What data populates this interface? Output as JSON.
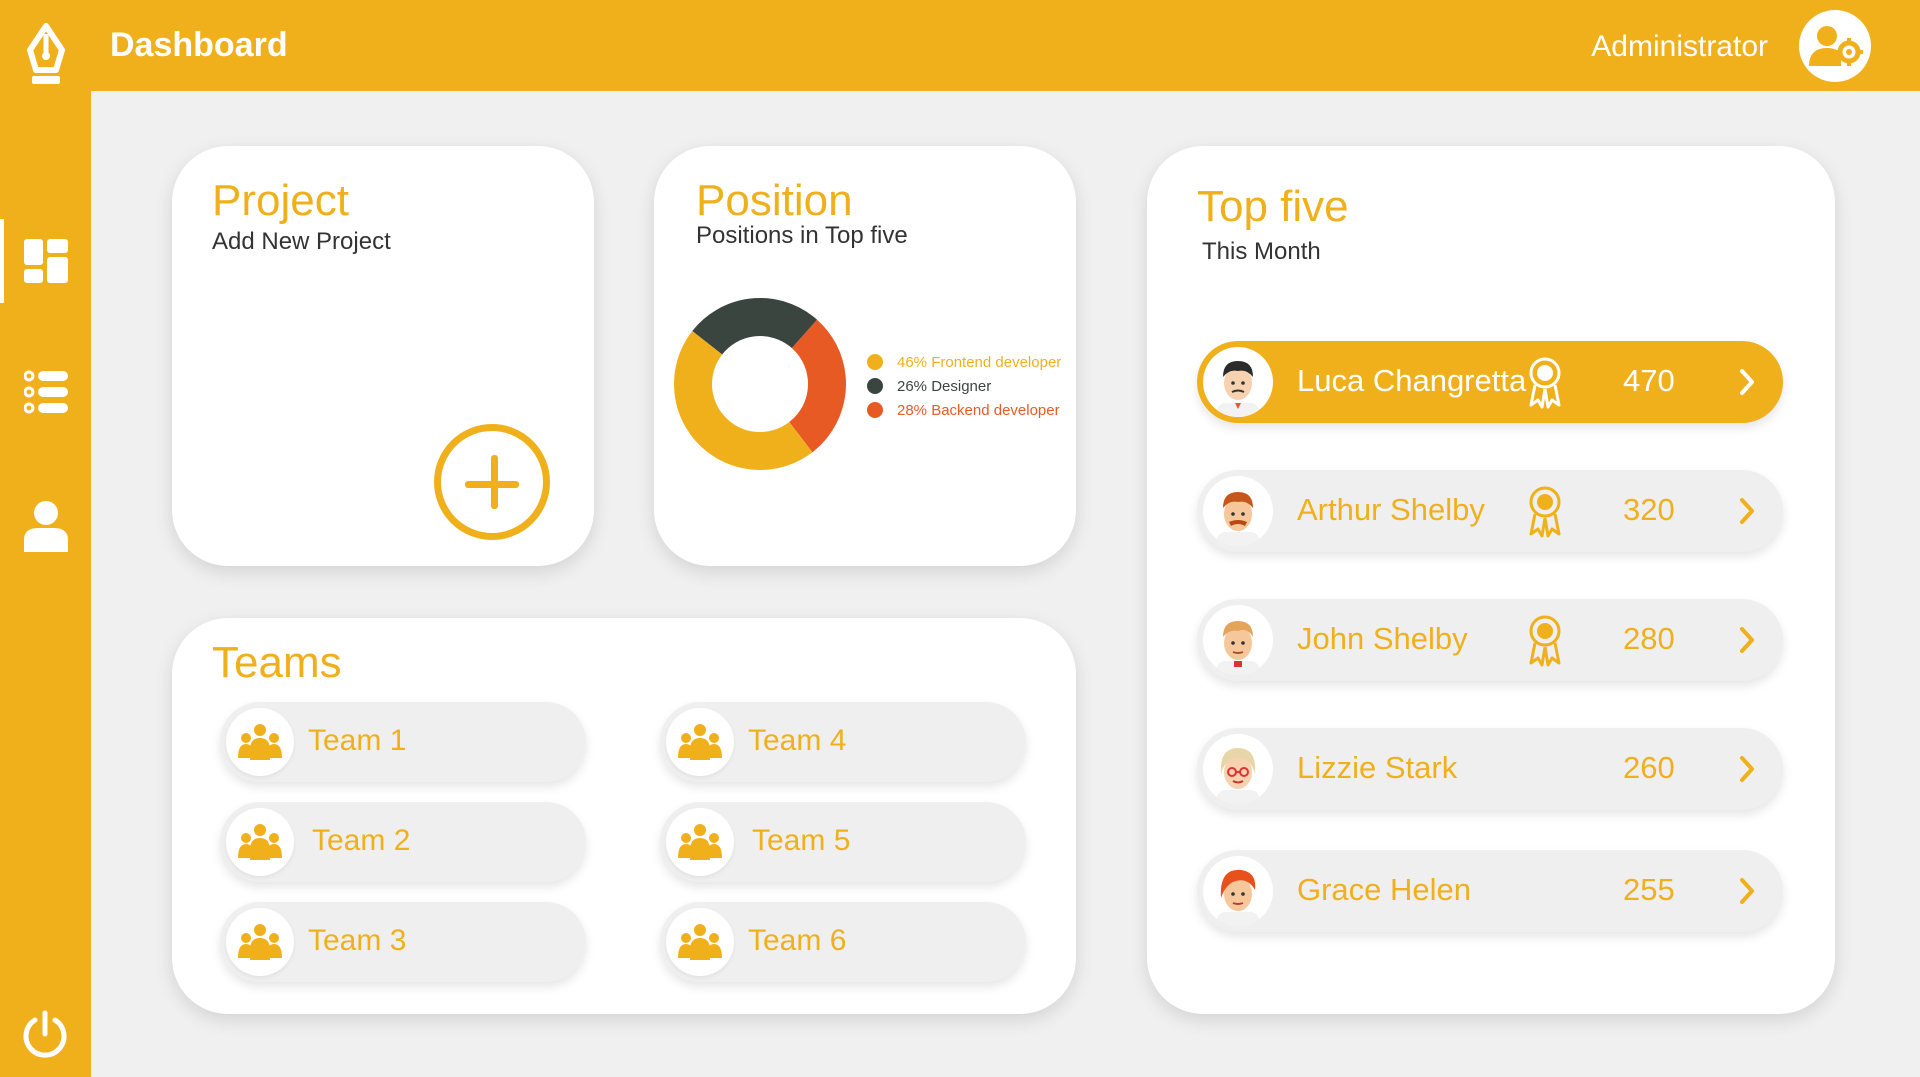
{
  "app": {
    "title": "Dashboard",
    "user": "Administrator"
  },
  "colors": {
    "accent": "#f0b01c",
    "dark": "#3b4540",
    "orange": "#e85a24"
  },
  "sidebar": {
    "items": [
      {
        "icon": "dashboard-icon",
        "active": true
      },
      {
        "icon": "list-icon",
        "active": false
      },
      {
        "icon": "user-icon",
        "active": false
      }
    ],
    "logout_icon": "power-icon"
  },
  "project": {
    "title": "Project",
    "subtitle": "Add New Project",
    "button_icon": "plus-icon"
  },
  "position": {
    "title": "Position",
    "subtitle": "Positions in Top five",
    "legend": [
      {
        "label": "46% Frontend developer",
        "color": "#f0b01c"
      },
      {
        "label": "26% Designer",
        "color": "#3b4540"
      },
      {
        "label": "28% Backend developer",
        "color": "#e85a24"
      }
    ]
  },
  "chart_data": {
    "type": "pie",
    "categories": [
      "Frontend developer",
      "Designer",
      "Backend developer"
    ],
    "values": [
      46,
      26,
      28
    ],
    "colors": [
      "#f0b01c",
      "#3b4540",
      "#e85a24"
    ],
    "donut": true
  },
  "teams": {
    "title": "Teams",
    "items": [
      "Team 1",
      "Team 2",
      "Team 3",
      "Team 4",
      "Team 5",
      "Team 6"
    ]
  },
  "top_five": {
    "title": "Top five",
    "subtitle": "This Month",
    "rows": [
      {
        "name": "Luca Changretta",
        "score": "470",
        "badge": true
      },
      {
        "name": "Arthur Shelby",
        "score": "320",
        "badge": true
      },
      {
        "name": "John Shelby",
        "score": "280",
        "badge": true
      },
      {
        "name": "Lizzie Stark",
        "score": "260",
        "badge": false
      },
      {
        "name": "Grace Helen",
        "score": "255",
        "badge": false
      }
    ]
  }
}
